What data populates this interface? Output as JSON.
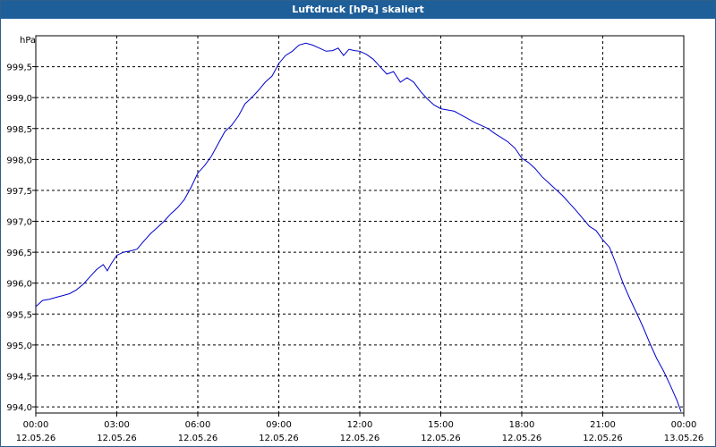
{
  "window": {
    "title": "Luftdruck [hPa] skaliert"
  },
  "chart_data": {
    "type": "line",
    "title": "Luftdruck [hPa] skaliert",
    "ylabel": "hPa",
    "xlabel": "",
    "ylim": [
      993.9,
      1000.0
    ],
    "xlim": [
      0,
      24
    ],
    "grid": true,
    "yticks": [
      {
        "value": 994.0,
        "label": "994,0"
      },
      {
        "value": 994.5,
        "label": "994,5"
      },
      {
        "value": 995.0,
        "label": "995,0"
      },
      {
        "value": 995.5,
        "label": "995,5"
      },
      {
        "value": 996.0,
        "label": "996,0"
      },
      {
        "value": 996.5,
        "label": "996,5"
      },
      {
        "value": 997.0,
        "label": "997,0"
      },
      {
        "value": 997.5,
        "label": "997,5"
      },
      {
        "value": 998.0,
        "label": "998,0"
      },
      {
        "value": 998.5,
        "label": "998,5"
      },
      {
        "value": 999.0,
        "label": "999,0"
      },
      {
        "value": 999.5,
        "label": "999,5"
      }
    ],
    "xticks": [
      {
        "value": 0,
        "time": "00:00",
        "date": "12.05.26"
      },
      {
        "value": 3,
        "time": "03:00",
        "date": "12.05.26"
      },
      {
        "value": 6,
        "time": "06:00",
        "date": "12.05.26"
      },
      {
        "value": 9,
        "time": "09:00",
        "date": "12.05.26"
      },
      {
        "value": 12,
        "time": "12:00",
        "date": "12.05.26"
      },
      {
        "value": 15,
        "time": "15:00",
        "date": "12.05.26"
      },
      {
        "value": 18,
        "time": "18:00",
        "date": "12.05.26"
      },
      {
        "value": 21,
        "time": "21:00",
        "date": "12.05.26"
      },
      {
        "value": 24,
        "time": "00:00",
        "date": "13.05.26"
      }
    ],
    "series": [
      {
        "color": "#0000cc",
        "x": [
          0.0,
          0.25,
          0.5,
          0.75,
          1.0,
          1.25,
          1.5,
          1.75,
          2.0,
          2.25,
          2.5,
          2.65,
          2.8,
          3.0,
          3.25,
          3.5,
          3.75,
          4.0,
          4.25,
          4.5,
          4.75,
          5.0,
          5.25,
          5.5,
          5.75,
          6.0,
          6.25,
          6.5,
          6.75,
          7.0,
          7.25,
          7.5,
          7.75,
          8.0,
          8.25,
          8.5,
          8.75,
          9.0,
          9.25,
          9.5,
          9.75,
          10.0,
          10.25,
          10.5,
          10.75,
          11.0,
          11.2,
          11.4,
          11.6,
          11.8,
          12.0,
          12.25,
          12.5,
          12.75,
          13.0,
          13.25,
          13.5,
          13.75,
          14.0,
          14.25,
          14.5,
          14.75,
          15.0,
          15.25,
          15.5,
          15.75,
          16.0,
          16.25,
          16.5,
          16.75,
          17.0,
          17.25,
          17.5,
          17.75,
          18.0,
          18.25,
          18.5,
          18.75,
          19.0,
          19.25,
          19.5,
          19.75,
          20.0,
          20.25,
          20.5,
          20.75,
          21.0,
          21.25,
          21.5,
          21.75,
          22.0,
          22.25,
          22.5,
          22.75,
          23.0,
          23.25,
          23.5,
          23.75,
          23.9
        ],
        "y": [
          995.62,
          995.72,
          995.74,
          995.77,
          995.8,
          995.83,
          995.89,
          995.98,
          996.1,
          996.22,
          996.3,
          996.2,
          996.32,
          996.45,
          996.5,
          996.52,
          996.55,
          996.68,
          996.8,
          996.9,
          997.0,
          997.12,
          997.22,
          997.35,
          997.55,
          997.78,
          997.9,
          998.05,
          998.25,
          998.45,
          998.55,
          998.7,
          998.9,
          999.0,
          999.12,
          999.25,
          999.35,
          999.55,
          999.68,
          999.75,
          999.85,
          999.88,
          999.85,
          999.8,
          999.75,
          999.76,
          999.8,
          999.68,
          999.78,
          999.76,
          999.75,
          999.7,
          999.62,
          999.5,
          999.38,
          999.42,
          999.25,
          999.32,
          999.25,
          999.1,
          998.98,
          998.88,
          998.82,
          998.8,
          998.78,
          998.72,
          998.66,
          998.6,
          998.55,
          998.5,
          998.42,
          998.35,
          998.28,
          998.18,
          998.02,
          997.95,
          997.85,
          997.72,
          997.62,
          997.52,
          997.42,
          997.3,
          997.18,
          997.05,
          996.92,
          996.85,
          996.7,
          996.58,
          996.3,
          996.0,
          995.75,
          995.52,
          995.28,
          995.02,
          994.78,
          994.58,
          994.35,
          994.1,
          993.92
        ]
      }
    ]
  }
}
